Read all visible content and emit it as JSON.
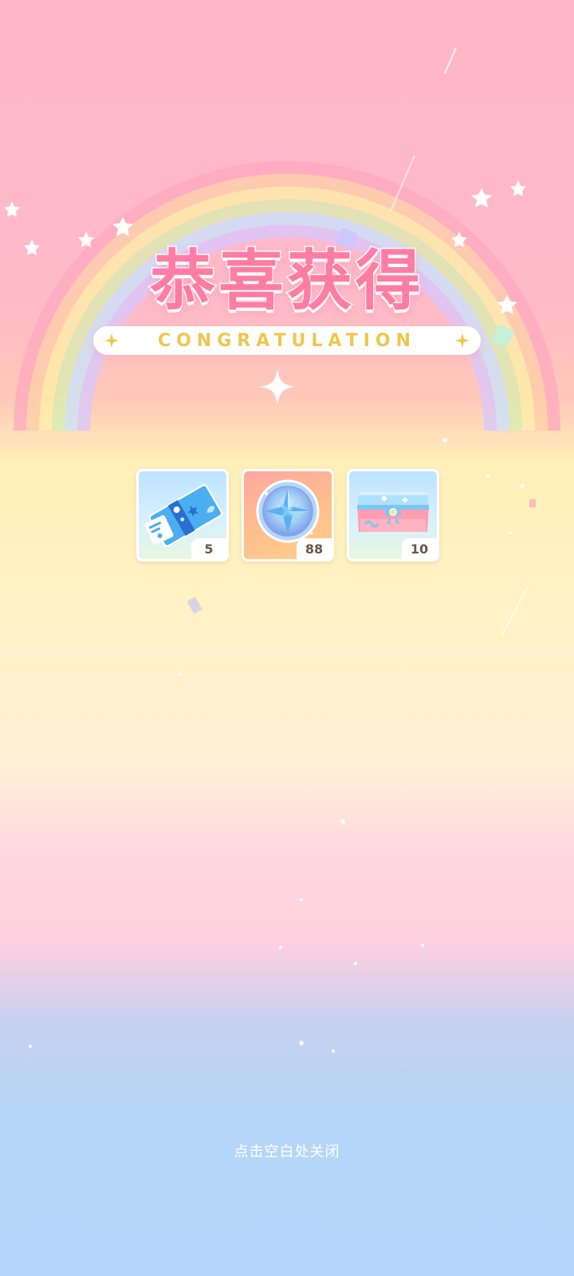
{
  "title": {
    "chinese": "恭喜获得",
    "english": "CONGRATULATION"
  },
  "rewards": [
    {
      "icon": "ticket-icon",
      "quantity": "5"
    },
    {
      "icon": "compass-star-coin-icon",
      "quantity": "88"
    },
    {
      "icon": "gift-box-icon",
      "quantity": "10"
    }
  ],
  "close_hint": "点击空白处关闭",
  "colors": {
    "title_pink": "#ff7ca4",
    "subtitle_gold": "#f0c64e",
    "quantity_text": "#6c5648"
  }
}
